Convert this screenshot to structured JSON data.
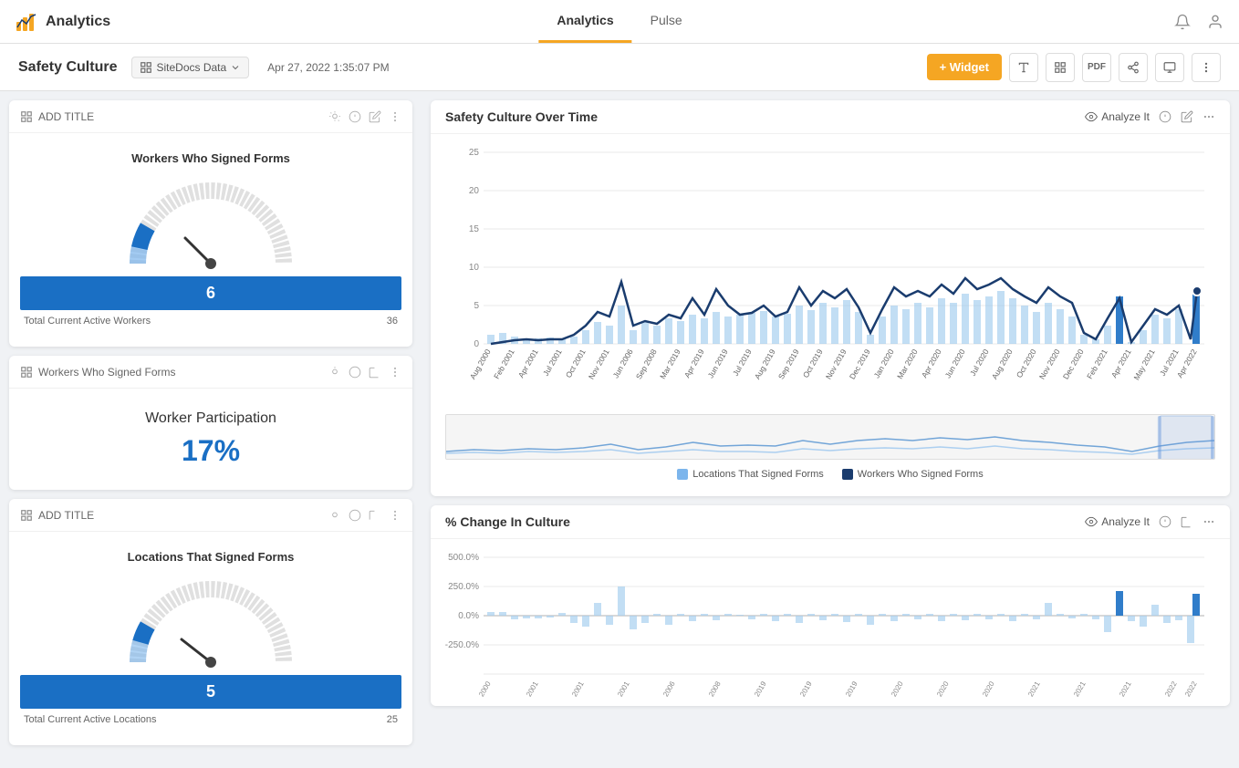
{
  "topNav": {
    "logo": "Analytics",
    "tabs": [
      {
        "label": "Analytics",
        "active": true
      },
      {
        "label": "Pulse",
        "active": false
      }
    ]
  },
  "subHeader": {
    "title": "Safety Culture",
    "dataSource": "SiteDocs Data",
    "date": "Apr 27, 2022 1:35:07 PM",
    "widgetBtn": "+ Widget"
  },
  "leftPanel": {
    "card1": {
      "title": "ADD TITLE",
      "gaugeTitle": "Workers Who Signed Forms",
      "gaugeMin": 0,
      "gaugeMax": 36,
      "gaugeValue": 6,
      "footerLabel": "Total Current Active Workers",
      "footerValue": 36
    },
    "card2": {
      "title": "Workers Who Signed Forms",
      "participationLabel": "Worker Participation",
      "participationValue": "17%"
    },
    "card3": {
      "title": "ADD TITLE",
      "gaugeTitle": "Locations That Signed Forms",
      "gaugeMin": 0,
      "gaugeMax": 25,
      "gaugeValue": 5,
      "footerLabel": "Total Current Active Locations",
      "footerValue": 25
    }
  },
  "rightPanel": {
    "chart1": {
      "title": "Safety Culture Over Time",
      "analyzeLabel": "Analyze It",
      "yLabels": [
        "25",
        "20",
        "15",
        "10",
        "5",
        "0"
      ],
      "legend": [
        {
          "label": "Locations That Signed Forms",
          "color": "#7cb5ec"
        },
        {
          "label": "Workers Who Signed Forms",
          "color": "#1a3c6e"
        }
      ]
    },
    "chart2": {
      "title": "% Change In Culture",
      "analyzeLabel": "Analyze It",
      "yLabels": [
        "500.0%",
        "250.0%",
        "0.0%",
        "-250.0%"
      ]
    }
  },
  "icons": {
    "bell": "🔔",
    "user": "👤",
    "text": "T",
    "image": "⊞",
    "pdf": "PDF",
    "share": "⇪",
    "monitor": "⬜",
    "more": "⋯",
    "bulb": "💡",
    "info": "ⓘ",
    "edit": "✏",
    "dataSourceIcon": "⊞",
    "analyzeIcon": "👁"
  }
}
